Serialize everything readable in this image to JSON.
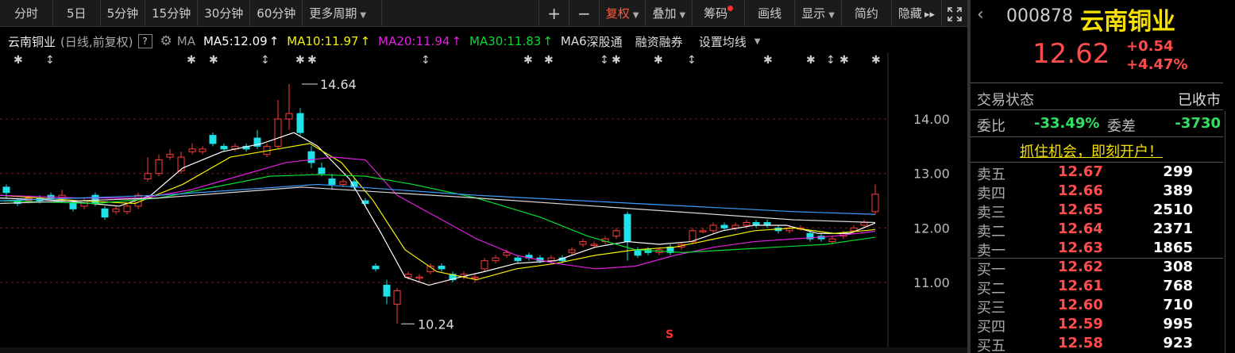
{
  "toolbar": {
    "periods": [
      "分时",
      "5日",
      "5分钟",
      "15分钟",
      "30分钟",
      "60分钟",
      "更多周期"
    ],
    "right_items": [
      "+",
      "−",
      "复权",
      "叠加",
      "筹码",
      "画线",
      "显示",
      "简约",
      "隐藏"
    ],
    "more_arrow": "▼",
    "hide_arrows": "▸▸",
    "fullscreen_icon": "fullscreen"
  },
  "info": {
    "name": "云南铜业",
    "mode": "(日线,前复权)",
    "help": "?",
    "ma_label": "MA",
    "ma5": "MA5:12.09",
    "ma10": "MA10:11.97",
    "ma20": "MA20:11.94",
    "ma30": "MA30:11.83",
    "ma6": "MA6",
    "links": [
      "深股通",
      "融资融券",
      "设置均线"
    ]
  },
  "colors": {
    "up": "#ff3b3b",
    "down": "#20e0e8",
    "ma5": "#ffffff",
    "ma10": "#f5f000",
    "ma20": "#e020e0",
    "ma30": "#00e030",
    "ma60": "#3aa0ff",
    "ma_other": "#d8d8d8",
    "accent": "#ff5a3c"
  },
  "chart_data": {
    "type": "candlestick",
    "yticks": [
      "14.00",
      "13.00",
      "12.00",
      "11.00"
    ],
    "ylim": [
      10.0,
      14.8
    ],
    "high_label": "14.64",
    "low_label": "10.24",
    "s_marker": "S",
    "series_names": [
      "MA5",
      "MA10",
      "MA20",
      "MA30"
    ]
  },
  "right": {
    "back_icon": "back-arrow",
    "code": "000878",
    "name": "云南铜业",
    "price": "12.62",
    "change": "+0.54",
    "pct": "+4.47%",
    "status_label": "交易状态",
    "status_value": "已收市",
    "wb_label": "委比",
    "wb_value": "-33.49%",
    "wc_label": "委差",
    "wc_value": "-3730",
    "promo": "抓住机会，即刻开户！",
    "asks": [
      {
        "l": "卖五",
        "p": "12.67",
        "v": "299"
      },
      {
        "l": "卖四",
        "p": "12.66",
        "v": "389"
      },
      {
        "l": "卖三",
        "p": "12.65",
        "v": "2510"
      },
      {
        "l": "卖二",
        "p": "12.64",
        "v": "2371"
      },
      {
        "l": "卖一",
        "p": "12.63",
        "v": "1865"
      }
    ],
    "bids": [
      {
        "l": "买一",
        "p": "12.62",
        "v": "308"
      },
      {
        "l": "买二",
        "p": "12.61",
        "v": "768"
      },
      {
        "l": "买三",
        "p": "12.60",
        "v": "710"
      },
      {
        "l": "买四",
        "p": "12.59",
        "v": "995"
      },
      {
        "l": "买五",
        "p": "12.58",
        "v": "923"
      }
    ]
  }
}
